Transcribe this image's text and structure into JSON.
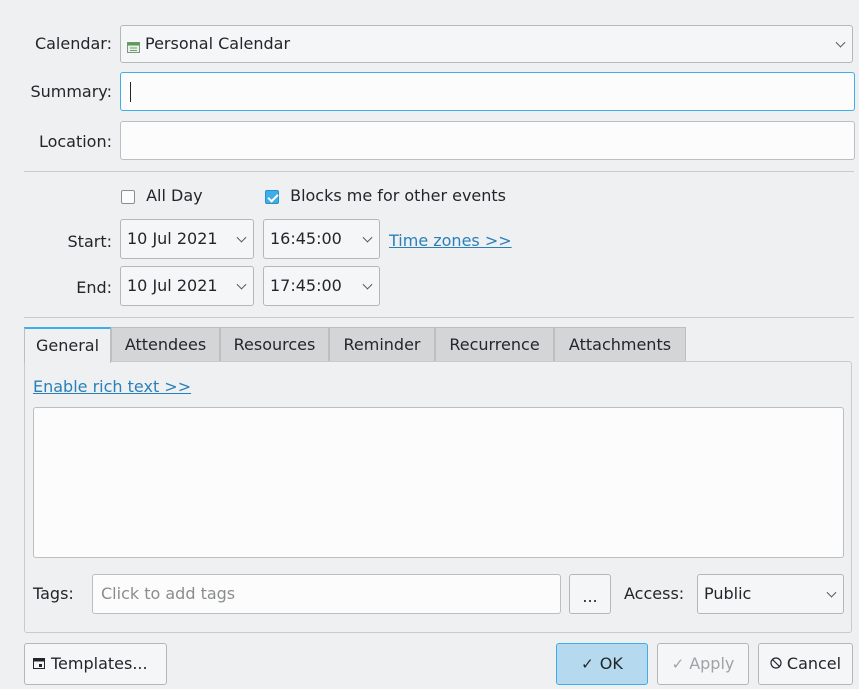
{
  "calendar": {
    "label": "Calendar:",
    "value": "Personal Calendar",
    "icon": "calendar-icon"
  },
  "summary": {
    "label": "Summary:",
    "value": ""
  },
  "location": {
    "label": "Location:",
    "value": ""
  },
  "options": {
    "all_day": {
      "label": "All Day",
      "checked": false
    },
    "blocks": {
      "label": "Blocks me for other events",
      "checked": true
    }
  },
  "start": {
    "label": "Start:",
    "date": "10 Jul 2021",
    "time": "16:45:00",
    "timezones_link": "Time zones >>"
  },
  "end": {
    "label": "End:",
    "date": "10 Jul 2021",
    "time": "17:45:00"
  },
  "tabs": [
    {
      "label": "General",
      "active": true
    },
    {
      "label": "Attendees"
    },
    {
      "label": "Resources"
    },
    {
      "label": "Reminder"
    },
    {
      "label": "Recurrence"
    },
    {
      "label": "Attachments"
    }
  ],
  "general": {
    "rich_text_link": "Enable rich text >>",
    "description": "",
    "tags_label": "Tags:",
    "tags_placeholder": "Click to add tags",
    "more_button": "...",
    "access_label": "Access:",
    "access_value": "Public"
  },
  "footer": {
    "templates": "Templates...",
    "ok": "OK",
    "apply": "Apply",
    "cancel": "Cancel"
  },
  "colors": {
    "accent": "#3daee9",
    "link": "#2980b9",
    "window_bg": "#eff0f1"
  }
}
